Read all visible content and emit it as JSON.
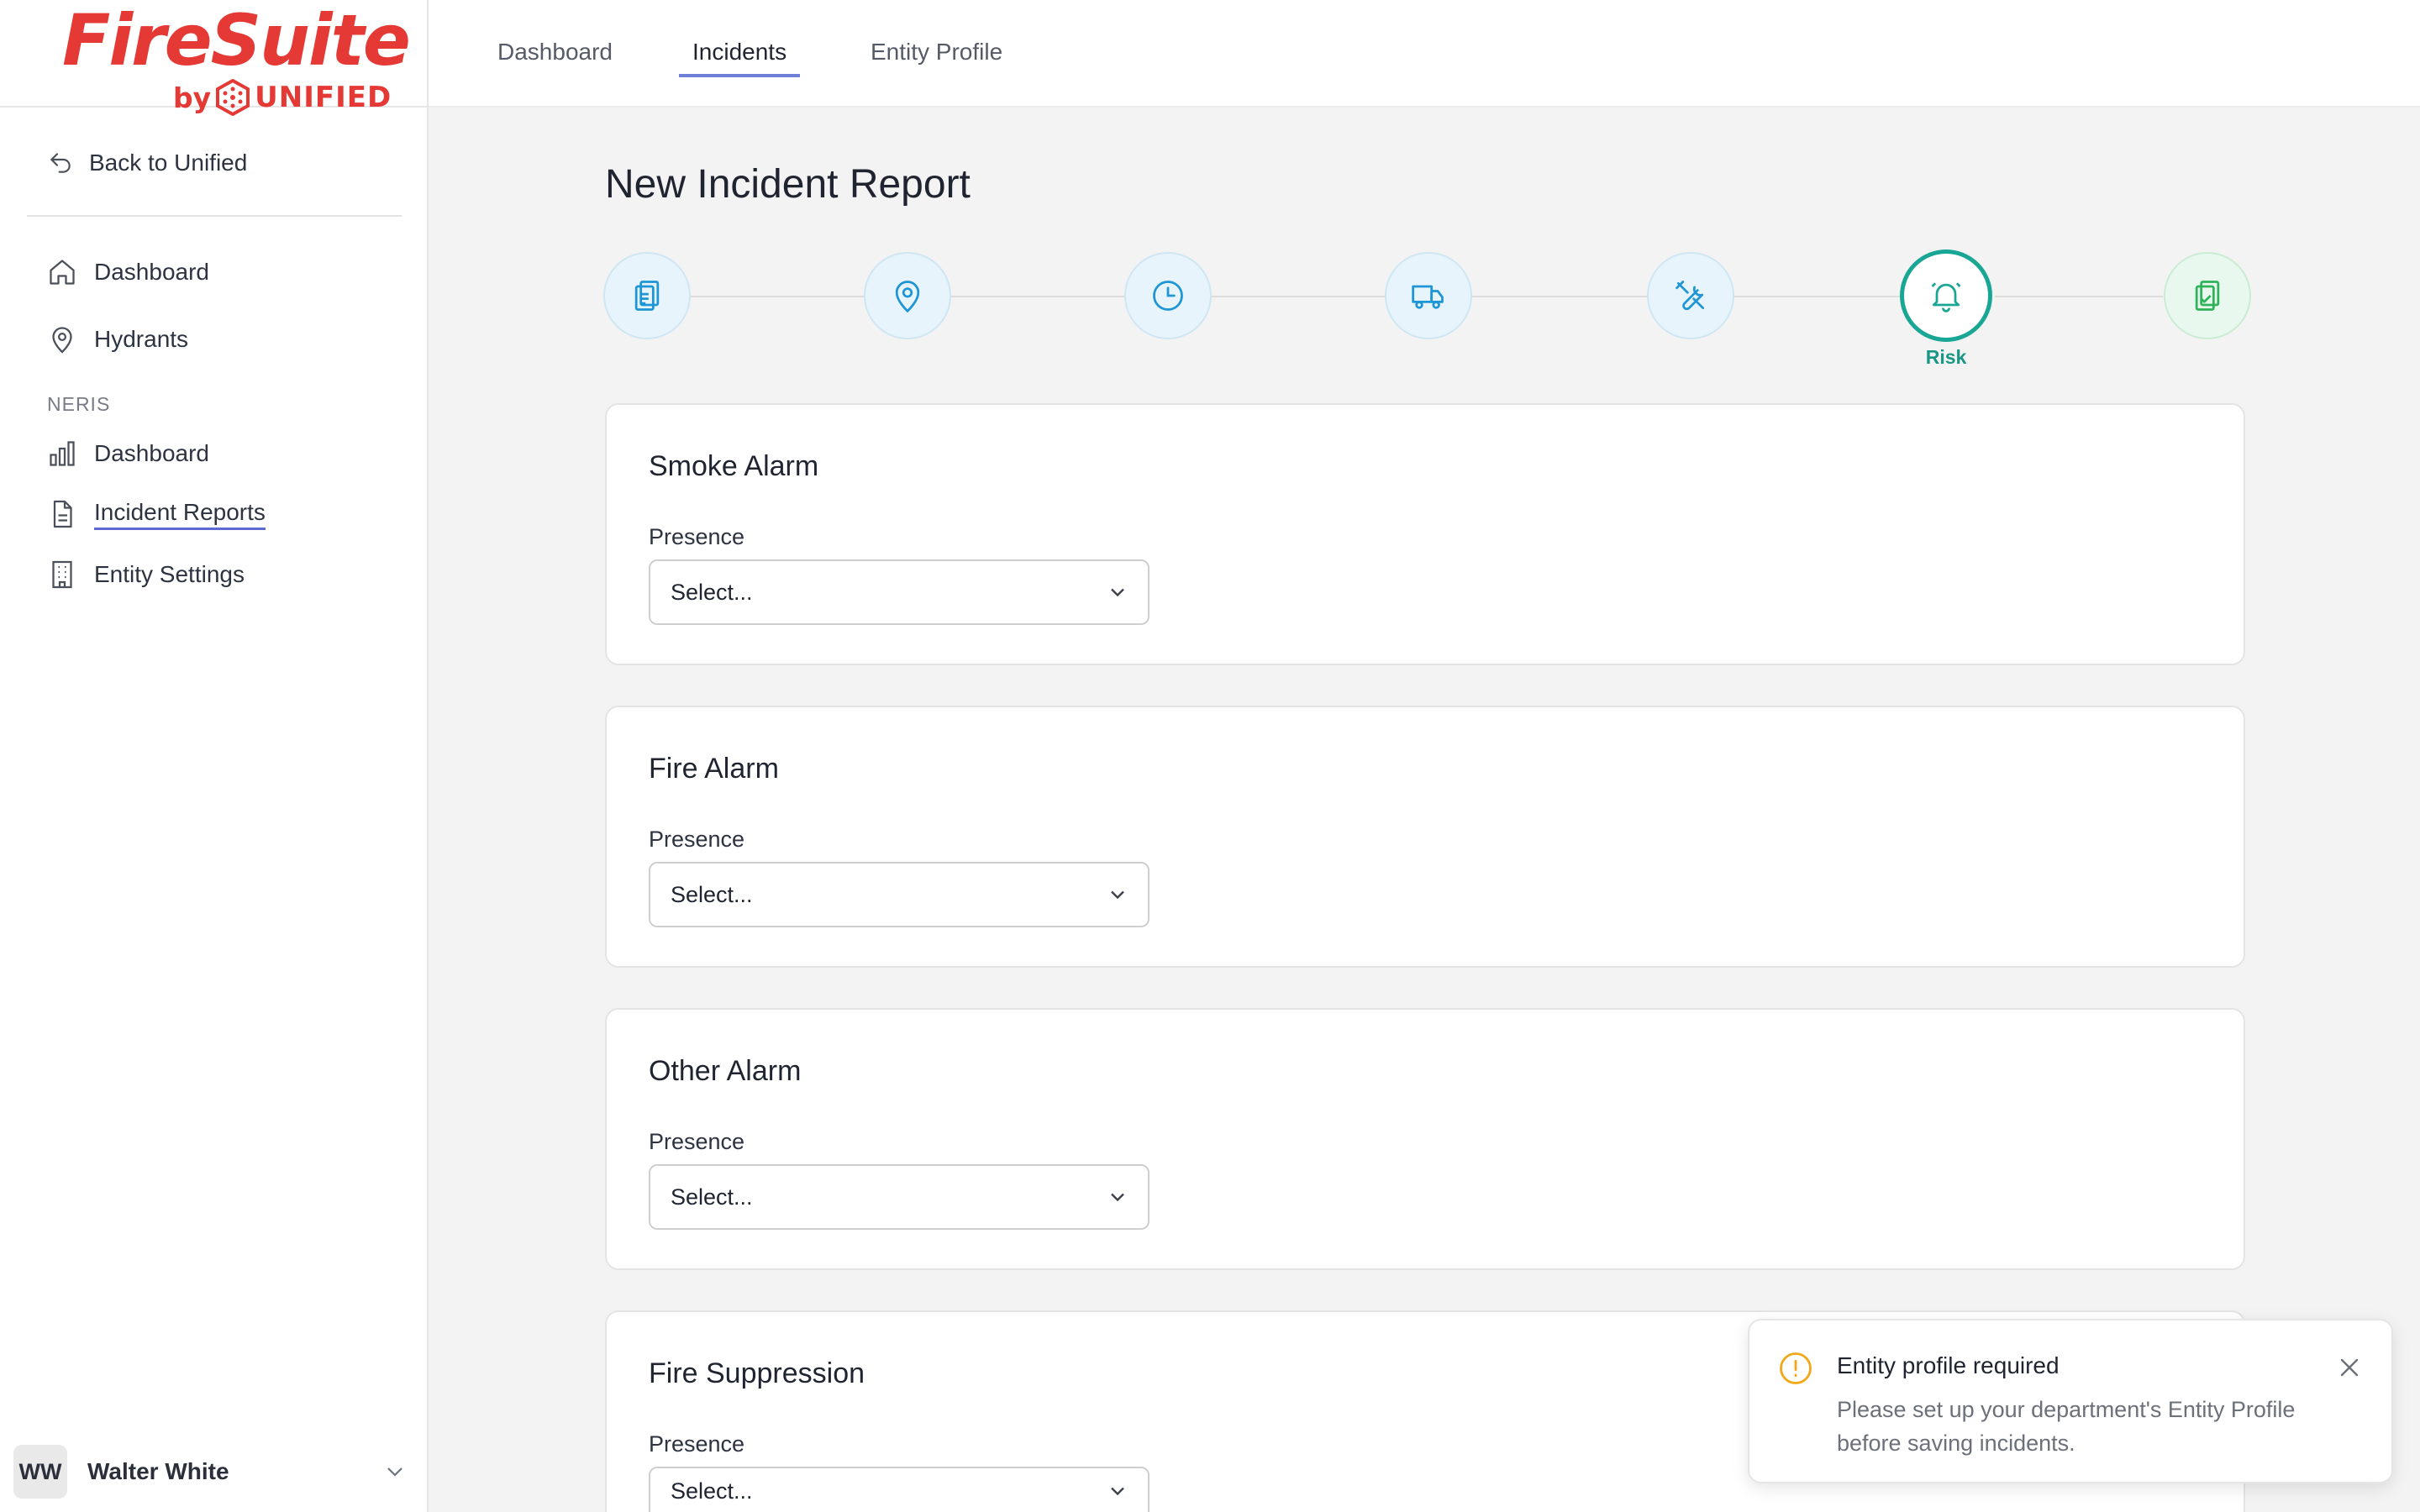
{
  "brand": {
    "logo_main": "FireSuite",
    "logo_by": "by",
    "logo_brand": "UNIFIED",
    "color": "#e53935"
  },
  "sidebar": {
    "back_label": "Back to Unified",
    "items": [
      {
        "label": "Dashboard",
        "icon": "home-icon"
      },
      {
        "label": "Hydrants",
        "icon": "map-pin-icon"
      }
    ],
    "section_label": "NERIS",
    "neris_items": [
      {
        "label": "Dashboard",
        "icon": "bar-chart-icon"
      },
      {
        "label": "Incident Reports",
        "icon": "document-icon",
        "active": true
      },
      {
        "label": "Entity Settings",
        "icon": "building-icon"
      }
    ],
    "user": {
      "initials": "WW",
      "name": "Walter White"
    }
  },
  "topbar": {
    "tabs": [
      {
        "label": "Dashboard"
      },
      {
        "label": "Incidents",
        "active": true
      },
      {
        "label": "Entity Profile"
      }
    ]
  },
  "main": {
    "title": "New Incident Report",
    "stepper": {
      "steps": [
        {
          "icon": "clipboard-icon"
        },
        {
          "icon": "location-icon"
        },
        {
          "icon": "clock-icon"
        },
        {
          "icon": "truck-icon"
        },
        {
          "icon": "tools-icon"
        },
        {
          "icon": "bell-icon",
          "label": "Risk",
          "current": true
        },
        {
          "icon": "clipboard-check-icon"
        }
      ],
      "accent": "#1aa694"
    },
    "sections": [
      {
        "title": "Smoke Alarm",
        "field_label": "Presence",
        "placeholder": "Select..."
      },
      {
        "title": "Fire Alarm",
        "field_label": "Presence",
        "placeholder": "Select..."
      },
      {
        "title": "Other Alarm",
        "field_label": "Presence",
        "placeholder": "Select..."
      },
      {
        "title": "Fire Suppression",
        "field_label": "Presence",
        "placeholder": "Select..."
      }
    ]
  },
  "toast": {
    "title": "Entity profile required",
    "message": "Please set up your department's Entity Profile before saving incidents.",
    "icon": "warning-circle-icon",
    "icon_color": "#f0a818"
  }
}
